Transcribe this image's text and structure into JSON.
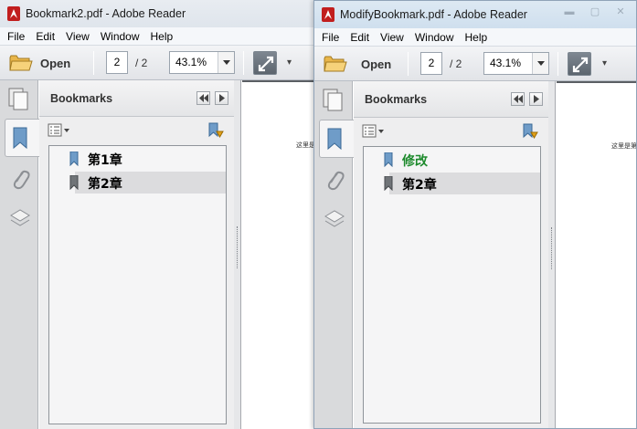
{
  "windows": [
    {
      "title": "Bookmark2.pdf - Adobe Reader",
      "menu": [
        "File",
        "Edit",
        "View",
        "Window",
        "Help"
      ],
      "toolbar": {
        "open_label": "Open",
        "page_current": "2",
        "page_total": "/ 2",
        "zoom": "43.1%"
      },
      "panel": {
        "title": "Bookmarks"
      },
      "bookmarks": [
        {
          "label": "第1章",
          "selected": false,
          "color": "#000000"
        },
        {
          "label": "第2章",
          "selected": true,
          "color": "#000000"
        }
      ],
      "document_text": "这里是第"
    },
    {
      "title": "ModifyBookmark.pdf - Adobe Reader",
      "menu": [
        "File",
        "Edit",
        "View",
        "Window",
        "Help"
      ],
      "toolbar": {
        "open_label": "Open",
        "page_current": "2",
        "page_total": "/ 2",
        "zoom": "43.1%"
      },
      "panel": {
        "title": "Bookmarks"
      },
      "bookmarks": [
        {
          "label": "修改",
          "selected": false,
          "color": "#1d8a2c"
        },
        {
          "label": "第2章",
          "selected": true,
          "color": "#000000"
        }
      ],
      "document_text": "这里是第"
    }
  ],
  "icons": {
    "app": "adobe-reader-icon",
    "open": "folder-icon",
    "fit": "fit-window-icon",
    "pages": "page-thumbnails-icon",
    "bookmarks": "bookmark-ribbon-icon",
    "attachments": "paperclip-icon",
    "layers": "layers-icon"
  },
  "colors": {
    "titlebar_inactive": "#e4e9ef",
    "titlebar_active": "#d6e4f1",
    "document_bg": "#5b5f64",
    "bookmark_modified": "#1d8a2c"
  }
}
